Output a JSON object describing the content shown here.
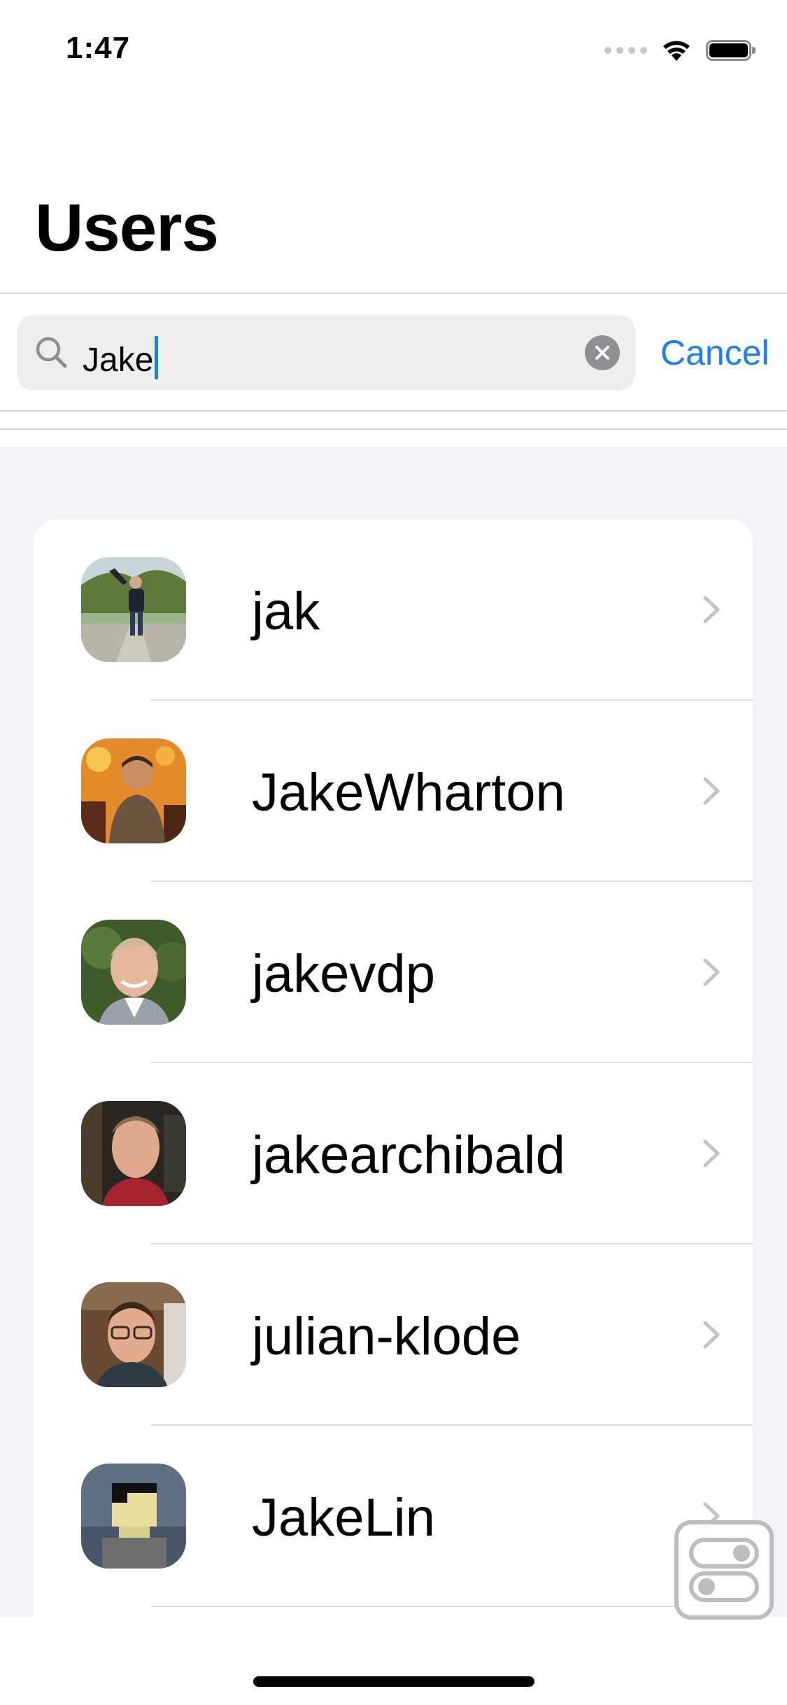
{
  "status_bar": {
    "time": "1:47",
    "icons": [
      "signal-dots-icon",
      "wifi-icon",
      "battery-icon"
    ]
  },
  "navigation": {
    "title": "Users"
  },
  "search": {
    "value": "Jake",
    "clear_icon": "clear-circle-icon",
    "cancel_label": "Cancel"
  },
  "colors": {
    "accent": "#1A7EF6",
    "grouped_background": "#F2F2F7",
    "separator": "#DCDCE0"
  },
  "users": [
    {
      "username": "jak",
      "avatar": "photo-person-park"
    },
    {
      "username": "JakeWharton",
      "avatar": "photo-person-orange-lights"
    },
    {
      "username": "jakevdp",
      "avatar": "photo-person-smiling"
    },
    {
      "username": "jakearchibald",
      "avatar": "photo-person-indoor"
    },
    {
      "username": "julian-klode",
      "avatar": "photo-person-glasses"
    },
    {
      "username": "JakeLin",
      "avatar": "pixel-art-avatar"
    }
  ],
  "floating_button": {
    "icon": "toggle-switches-icon"
  }
}
